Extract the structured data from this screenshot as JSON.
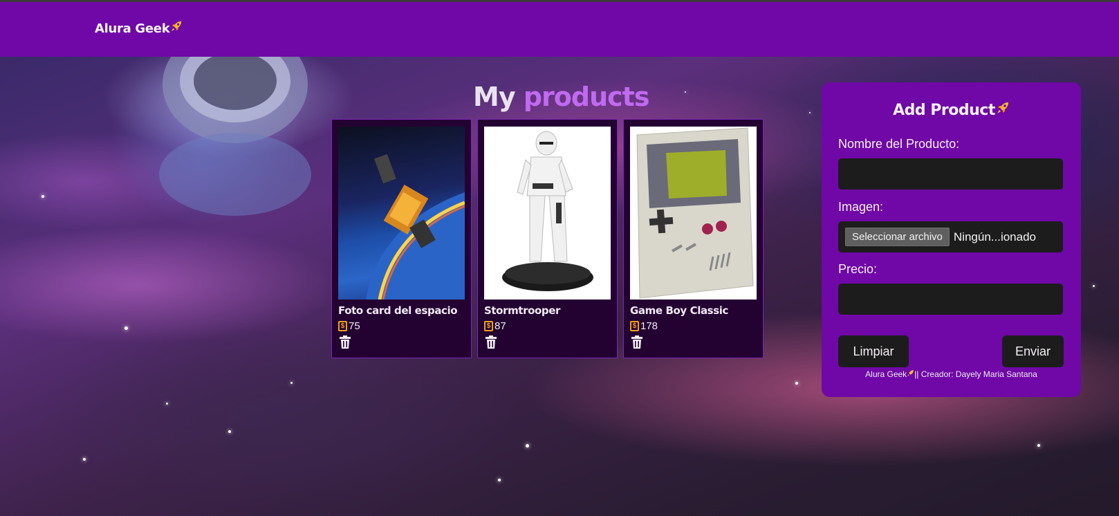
{
  "header": {
    "brand": "Alura Geek"
  },
  "main": {
    "title_part1": "My",
    "title_part2": "products",
    "products": [
      {
        "name": "Foto card del espacio",
        "price": "75"
      },
      {
        "name": "Stormtrooper",
        "price": "87"
      },
      {
        "name": "Game Boy Classic",
        "price": "178"
      }
    ]
  },
  "form": {
    "title": "Add Product",
    "name_label": "Nombre del Producto:",
    "image_label": "Imagen:",
    "file_button": "Seleccionar archivo",
    "file_status": "Ningún...ionado",
    "price_label": "Precio:",
    "clear_button": "Limpiar",
    "send_button": "Enviar",
    "credit_brand": "Alura Geek",
    "credit_text": "|| Creador: Dayely Maria Santana"
  },
  "colors": {
    "header_bg": "#6f08a6",
    "accent_title": "#c06af0",
    "card_bg": "#230232",
    "field_bg": "#1c1c1c",
    "coin": "#f0a21a"
  }
}
